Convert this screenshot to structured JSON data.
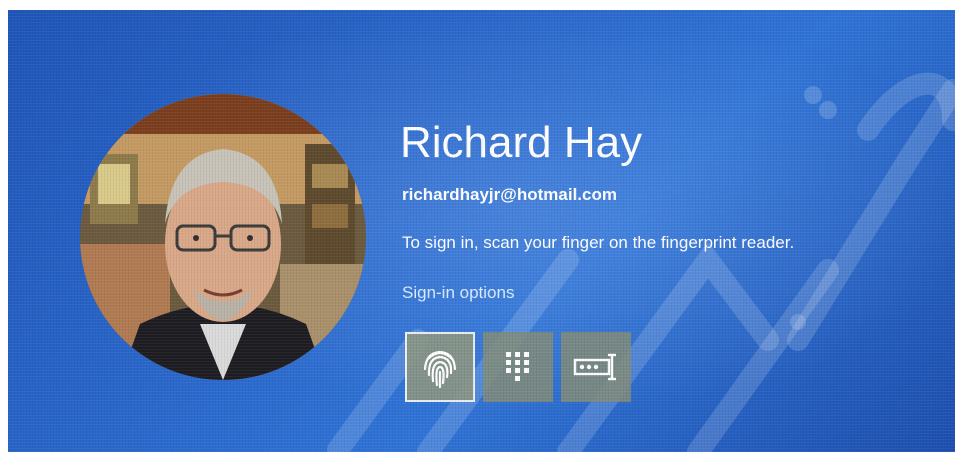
{
  "user": {
    "name": "Richard Hay",
    "email": "richardhayjr@hotmail.com"
  },
  "prompt": {
    "instruction": "To sign in, scan your finger on the fingerprint reader."
  },
  "signin": {
    "options_label": "Sign-in options",
    "options": [
      {
        "id": "fingerprint",
        "icon": "fingerprint-icon",
        "selected": true
      },
      {
        "id": "pin",
        "icon": "keypad-icon",
        "selected": false
      },
      {
        "id": "password",
        "icon": "password-field-icon",
        "selected": false
      }
    ]
  },
  "colors": {
    "background": "#2a68cc",
    "text": "#ffffff",
    "link": "#d9ecff",
    "tile": "#828c78"
  }
}
